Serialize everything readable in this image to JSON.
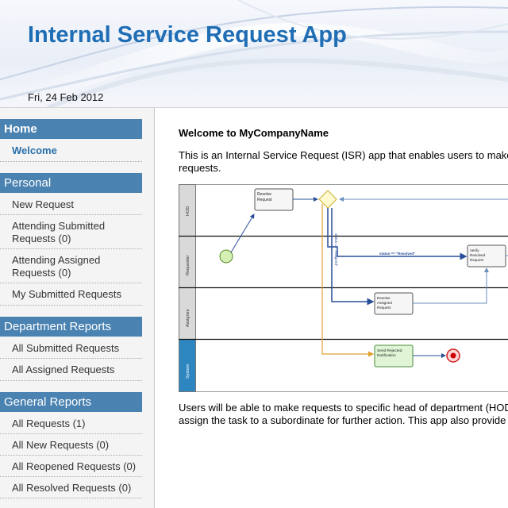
{
  "header": {
    "title": "Internal Service Request App",
    "date": "Fri, 24 Feb 2012"
  },
  "sidebar": {
    "home": {
      "heading": "Home",
      "items": [
        "Welcome"
      ]
    },
    "personal": {
      "heading": "Personal",
      "items": [
        "New Request",
        "Attending Submitted Requests (0)",
        "Attending Assigned Requests (0)",
        "My Submitted Requests"
      ]
    },
    "department": {
      "heading": "Department Reports",
      "items": [
        "All Submitted Requests",
        "All Assigned Requests"
      ]
    },
    "general": {
      "heading": "General Reports",
      "items": [
        "All Requests (1)",
        "All New Requests (0)",
        "All Reopened Requests (0)",
        "All Resolved Requests (0)"
      ]
    }
  },
  "main": {
    "welcome_title": "Welcome to MyCompanyName",
    "intro_line1": "This is an Internal Service Request (ISR) app that enables users to make",
    "intro_line2": "requests.",
    "outro_line1": "Users will be able to make requests to specific head of department (HOD",
    "outro_line2": "assign the task to a subordinate for further action. This app also provide"
  },
  "diagram": {
    "lanes": [
      "HOD",
      "Requester",
      "Assignee",
      "System"
    ],
    "tasks": {
      "resolve_request": "Resolve Request",
      "verify_resolved": "Verify Resolved Request",
      "resolve_assigned": "Resolve Assigned Request",
      "send_rejected": "Send Rejected Notification"
    },
    "labels": {
      "status_resolved": "status == \"Resolved\"",
      "status_assigned": "status == \"Assigned\""
    }
  }
}
